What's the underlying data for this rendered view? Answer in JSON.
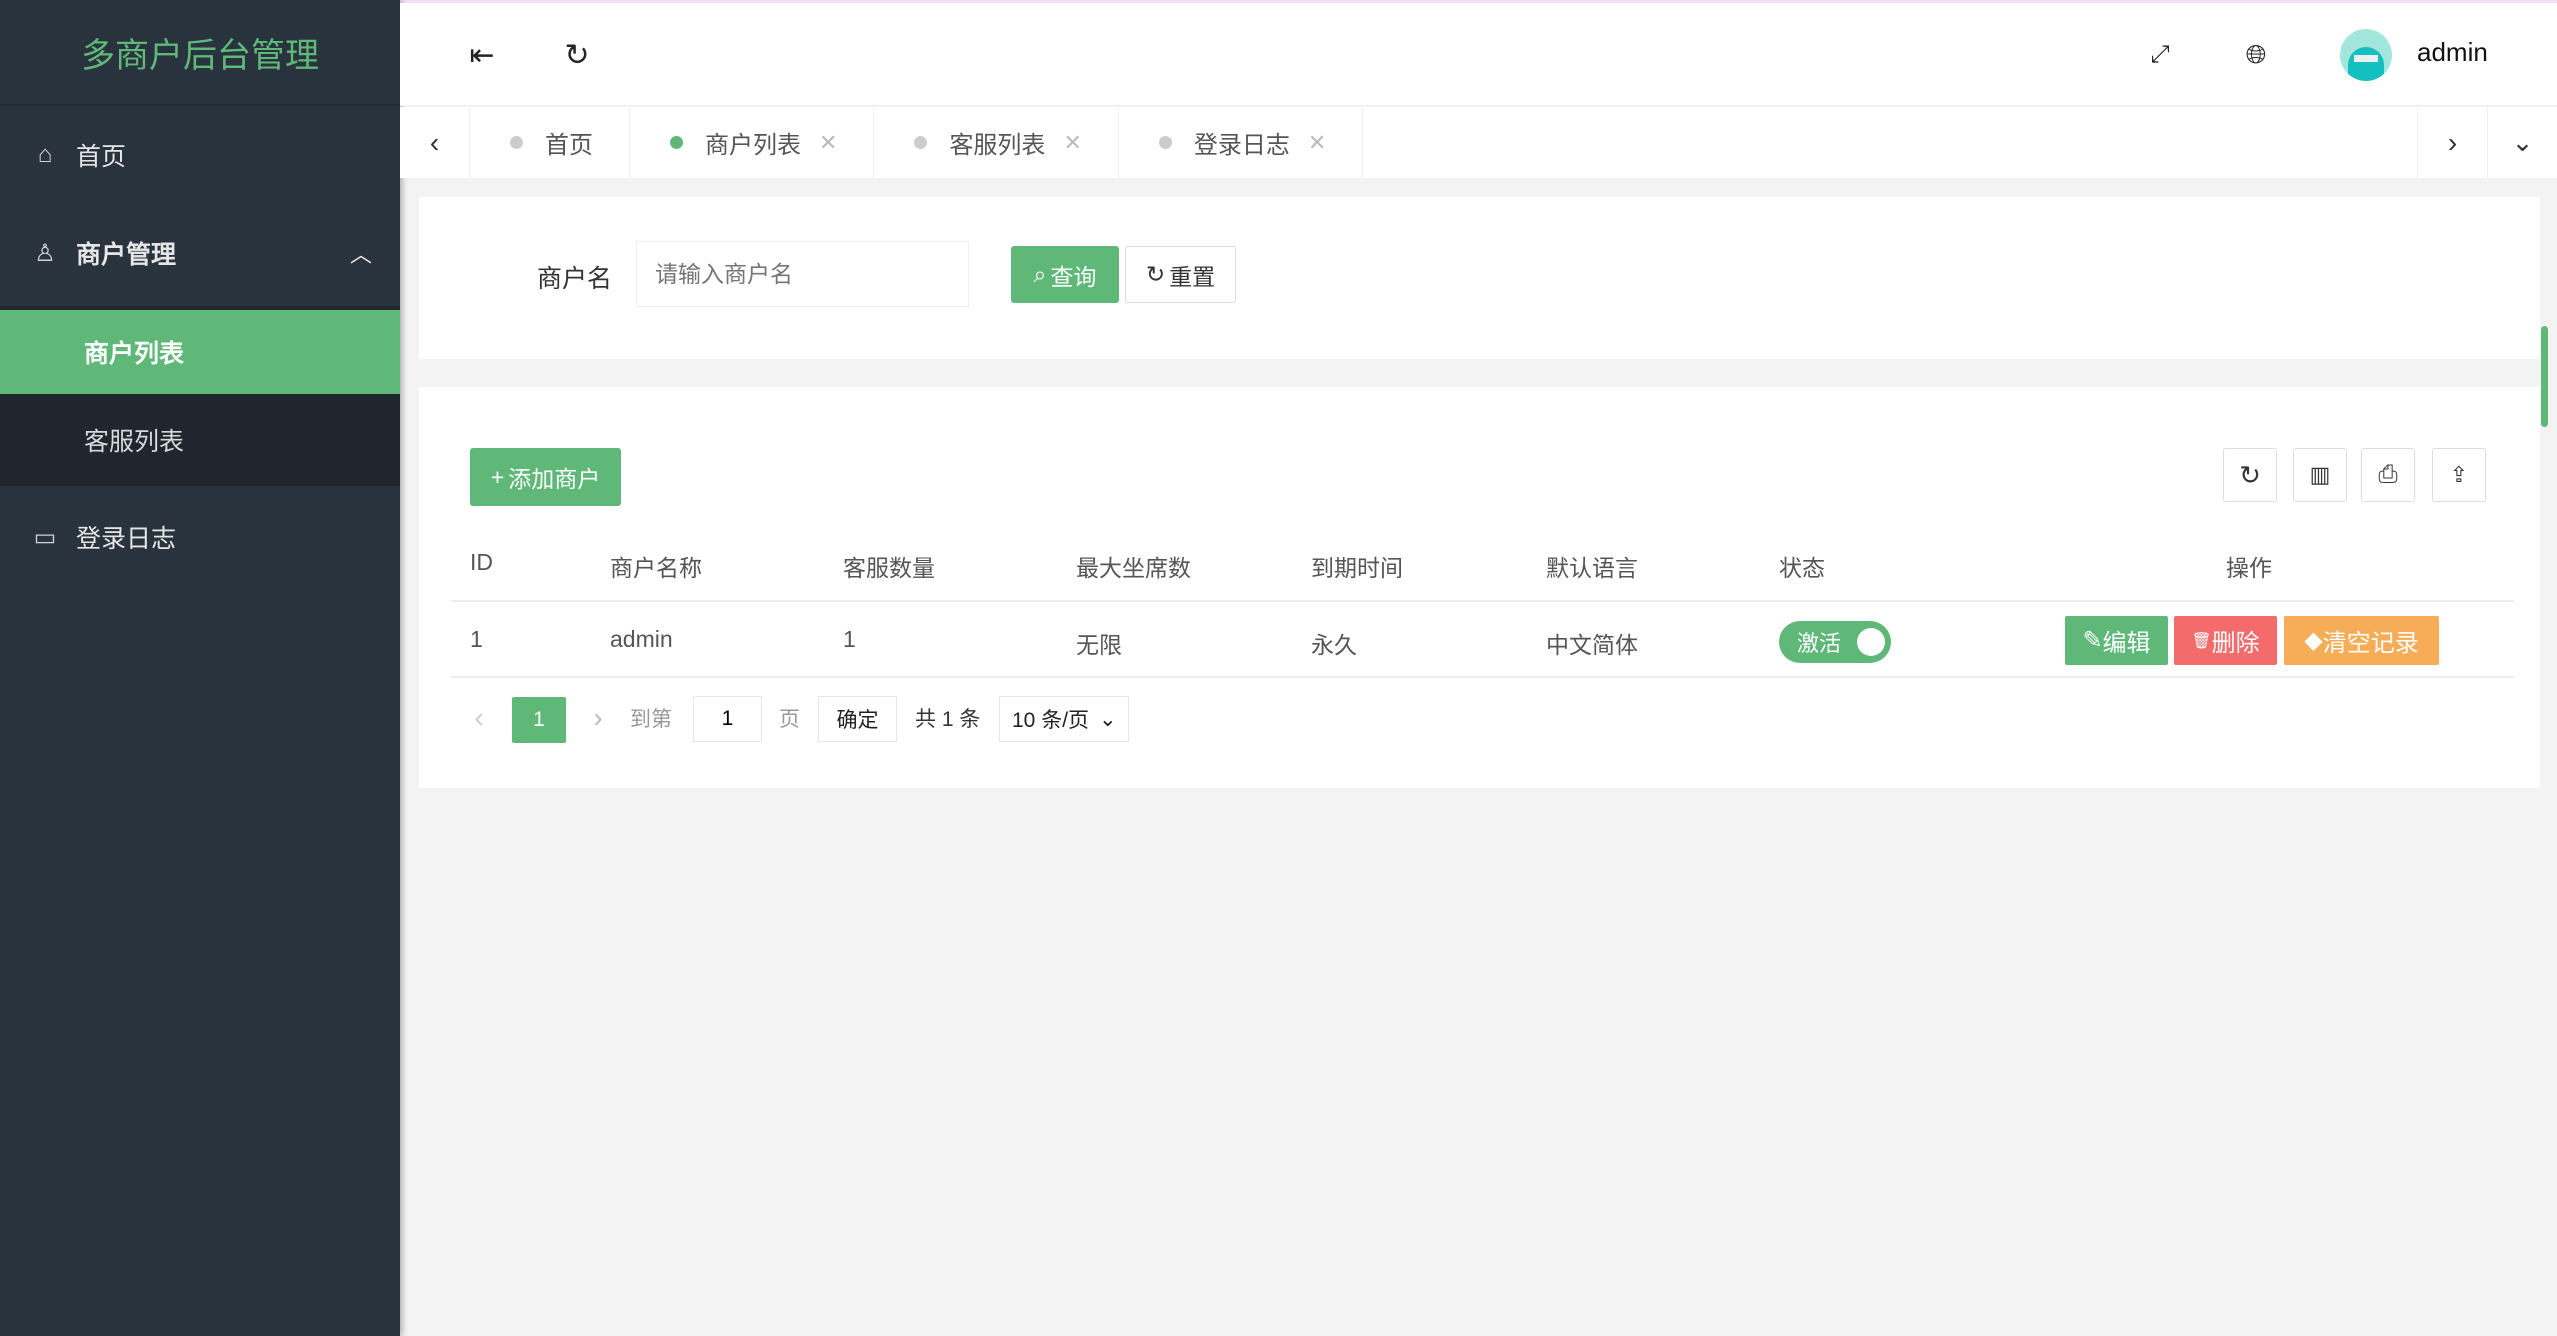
{
  "app": {
    "title": "多商户后台管理"
  },
  "sidebar": {
    "items": [
      {
        "label": "首页",
        "icon": "home-icon"
      },
      {
        "label": "商户管理",
        "icon": "user-icon",
        "expanded": true,
        "children": [
          {
            "label": "商户列表",
            "active": true
          },
          {
            "label": "客服列表"
          }
        ]
      },
      {
        "label": "登录日志",
        "icon": "calendar-icon"
      }
    ]
  },
  "header": {
    "user": "admin",
    "icons": [
      "menu-fold-icon",
      "refresh-icon",
      "fullscreen-icon",
      "globe-icon",
      "avatar"
    ]
  },
  "tabs": [
    {
      "label": "首页",
      "active": false
    },
    {
      "label": "商户列表",
      "active": true
    },
    {
      "label": "客服列表",
      "active": false
    },
    {
      "label": "登录日志",
      "active": false
    }
  ],
  "search": {
    "label": "商户名",
    "placeholder": "请输入商户名",
    "query_label": "查询",
    "reset_label": "重置"
  },
  "table": {
    "add_label": "添加商户",
    "columns": [
      "ID",
      "商户名称",
      "客服数量",
      "最大坐席数",
      "到期时间",
      "默认语言",
      "状态",
      "操作"
    ],
    "rows": [
      {
        "id": "1",
        "name": "admin",
        "agents": "1",
        "max_seats": "无限",
        "expire": "永久",
        "language": "中文简体",
        "status": "激活",
        "status_on": true
      }
    ],
    "actions": {
      "edit": "编辑",
      "delete": "删除",
      "clear": "清空记录"
    }
  },
  "pagination": {
    "current": "1",
    "goto_label": "到第",
    "goto_value": "1",
    "page_label": "页",
    "confirm_label": "确定",
    "total": "共 1 条",
    "page_size": "10 条/页"
  },
  "colors": {
    "sidebar": "#28333e",
    "accent": "#5fb878",
    "danger": "#f36b6b",
    "warning": "#f7ad57"
  }
}
